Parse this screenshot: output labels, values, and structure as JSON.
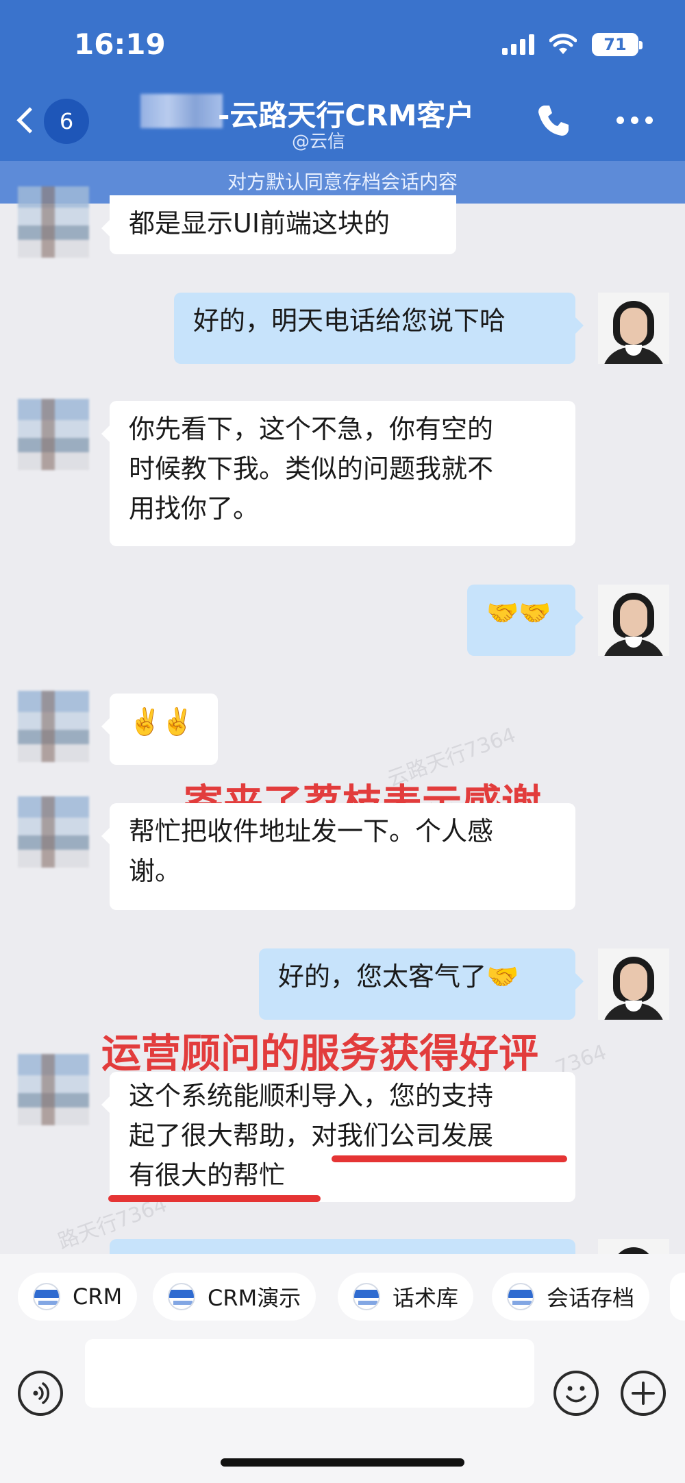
{
  "status_bar": {
    "time": "16:19",
    "battery": "71"
  },
  "header": {
    "unread_count": "6",
    "title": "-云路天行CRM客户",
    "subtitle": "@云信"
  },
  "archive_notice": "对方默认同意存档会话内容",
  "messages": [
    {
      "side": "in",
      "text": "都是显示UI前端这块的"
    },
    {
      "side": "out",
      "text": "好的，明天电话给您说下哈"
    },
    {
      "side": "in",
      "lines": [
        "你先看下，这个不急，你有空的",
        "时候教下我。类似的问题我就不",
        "用找你了。"
      ]
    },
    {
      "side": "out",
      "text": "🤝🤝"
    },
    {
      "side": "in",
      "text": "✌️✌️"
    },
    {
      "side": "in",
      "lines": [
        "帮忙把收件地址发一下。个人感",
        "谢。"
      ]
    },
    {
      "side": "out",
      "text": "好的，您太客气了🤝"
    },
    {
      "side": "in",
      "lines": [
        "这个系统能顺利导入，您的支持",
        "起了很大帮助，对我们公司发展",
        "有很大的帮忙"
      ]
    }
  ],
  "annotations": {
    "lychee": "寄来了荔枝表示感谢",
    "review": "运营顾问的服务获得好评"
  },
  "watermarks": [
    "云路天行7364",
    "路天行7364",
    "7364"
  ],
  "quick_actions": [
    {
      "label": "CRM"
    },
    {
      "label": "CRM演示"
    },
    {
      "label": "话术库"
    },
    {
      "label": "会话存档"
    }
  ],
  "colors": {
    "header_bg": "#3a73cc",
    "archive_bar_bg": "#5d8bd8",
    "outgoing_bubble": "#c7e3fb",
    "incoming_bubble": "#ffffff",
    "annotation_red": "#e23c3c"
  }
}
